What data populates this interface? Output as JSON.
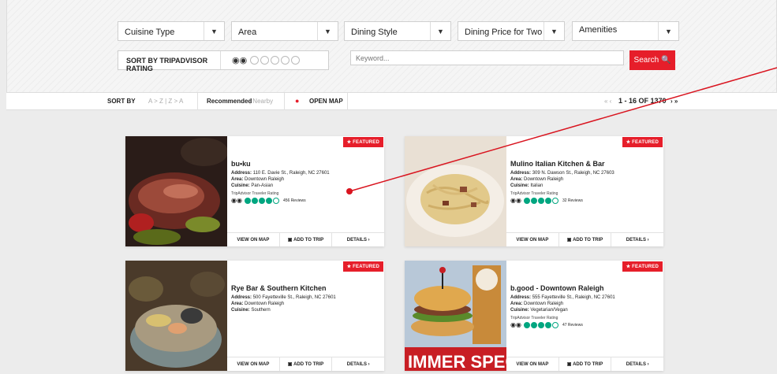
{
  "filters": {
    "cuisine": "Cuisine Type",
    "area": "Area",
    "dining_style": "Dining Style",
    "price": "Dining Price for Two",
    "amenities": "Amenities",
    "sort_rating_label": "SORT BY TRIPADVISOR RATING",
    "keyword_placeholder": "Keyword...",
    "search_label": "Search 🔍"
  },
  "sortbar": {
    "sort_by": "SORT BY",
    "alpha": "A > Z | Z > A",
    "recommended": "Recommended",
    "nearby": "| Nearby",
    "open_map": "OPEN MAP",
    "pager_prev": "« ‹",
    "pager_text": "1 - 16 OF 1370",
    "pager_next": "› »"
  },
  "cards": [
    {
      "featured": "FEATURED",
      "name": "bu•ku",
      "address": "110 E. Davie St., Raleigh, NC 27601",
      "area": "Downtown Raleigh",
      "cuisine": "Pan-Asian",
      "ta_label": "TripAdvisor Traveler Rating",
      "rating": 4,
      "reviews": "456 Reviews",
      "view_map": "VIEW ON MAP",
      "add_trip": "ADD TO TRIP",
      "details": "DETAILS ›"
    },
    {
      "featured": "FEATURED",
      "name": "Mulino Italian Kitchen & Bar",
      "address": "309 N. Dawson St., Raleigh, NC 27603",
      "area": "Downtown Raleigh",
      "cuisine": "Italian",
      "ta_label": "TripAdvisor Traveler Rating",
      "rating": 4,
      "reviews": "32 Reviews",
      "view_map": "VIEW ON MAP",
      "add_trip": "ADD TO TRIP",
      "details": "DETAILS ›"
    },
    {
      "featured": "FEATURED",
      "name": "Rye Bar & Southern Kitchen",
      "address": "500 Fayetteville St., Raleigh, NC 27601",
      "area": "Downtown Raleigh",
      "cuisine": "Southern",
      "view_map": "VIEW ON MAP",
      "add_trip": "ADD TO TRIP",
      "details": "DETAILS ›"
    },
    {
      "featured": "FEATURED",
      "name": "b.good - Downtown Raleigh",
      "address": "555 Fayetteville St., Raleigh, NC 27601",
      "area": "Downtown Raleigh",
      "cuisine": "Vegetarian/Vegan",
      "ta_label": "TripAdvisor Traveler Rating",
      "rating": 4,
      "reviews": "47 Reviews",
      "view_map": "VIEW ON MAP",
      "add_trip": "ADD TO TRIP",
      "details": "DETAILS ›"
    }
  ],
  "labels": {
    "address": "Address:",
    "area": "Area:",
    "cuisine": "Cuisine:"
  },
  "accent": "#e61e2a",
  "ta_green": "#00a680"
}
